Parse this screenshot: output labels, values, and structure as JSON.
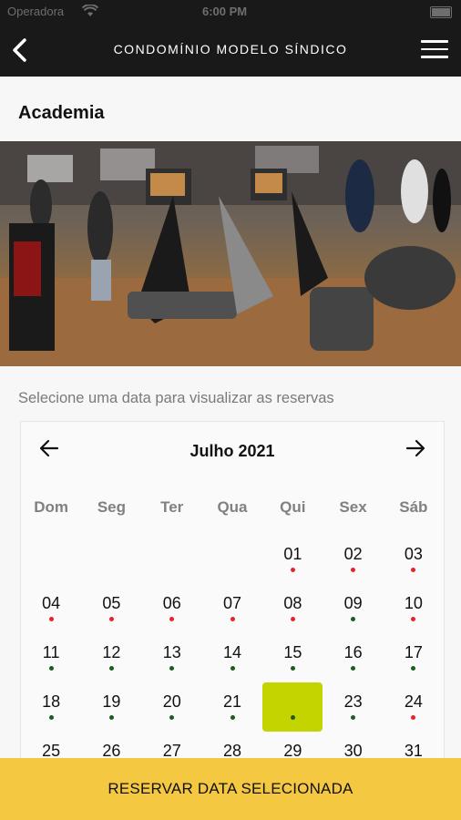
{
  "status": {
    "carrier": "Operadora",
    "time": "6:00 PM"
  },
  "nav": {
    "title": "CONDOMÍNIO MODELO SÍNDICO"
  },
  "page": {
    "title": "Academia",
    "instruction": "Selecione uma data para visualizar as reservas",
    "image": "gym-photo"
  },
  "calendar": {
    "month_label": "Julho 2021",
    "weekdays": [
      "Dom",
      "Seg",
      "Ter",
      "Qua",
      "Qui",
      "Sex",
      "Sáb"
    ],
    "leading_blanks": 4,
    "selected_day": "22",
    "colors": {
      "selected": "#c3d400",
      "red": "#e8222c",
      "green": "#1e5b1e"
    },
    "days": [
      {
        "day": "01",
        "dot": "red"
      },
      {
        "day": "02",
        "dot": "red"
      },
      {
        "day": "03",
        "dot": "red"
      },
      {
        "day": "04",
        "dot": "red"
      },
      {
        "day": "05",
        "dot": "red"
      },
      {
        "day": "06",
        "dot": "red"
      },
      {
        "day": "07",
        "dot": "red"
      },
      {
        "day": "08",
        "dot": "red"
      },
      {
        "day": "09",
        "dot": "green"
      },
      {
        "day": "10",
        "dot": "red"
      },
      {
        "day": "11",
        "dot": "green"
      },
      {
        "day": "12",
        "dot": "green"
      },
      {
        "day": "13",
        "dot": "green"
      },
      {
        "day": "14",
        "dot": "green"
      },
      {
        "day": "15",
        "dot": "green"
      },
      {
        "day": "16",
        "dot": "green"
      },
      {
        "day": "17",
        "dot": "green"
      },
      {
        "day": "18",
        "dot": "green"
      },
      {
        "day": "19",
        "dot": "green"
      },
      {
        "day": "20",
        "dot": "green"
      },
      {
        "day": "21",
        "dot": "green"
      },
      {
        "day": "22",
        "dot": "green"
      },
      {
        "day": "23",
        "dot": "green"
      },
      {
        "day": "24",
        "dot": "red"
      },
      {
        "day": "25",
        "dot": "none"
      },
      {
        "day": "26",
        "dot": "none"
      },
      {
        "day": "27",
        "dot": "none"
      },
      {
        "day": "28",
        "dot": "none"
      },
      {
        "day": "29",
        "dot": "none"
      },
      {
        "day": "30",
        "dot": "none"
      },
      {
        "day": "31",
        "dot": "none"
      }
    ]
  },
  "footer": {
    "button_label": "RESERVAR DATA SELECIONADA"
  }
}
